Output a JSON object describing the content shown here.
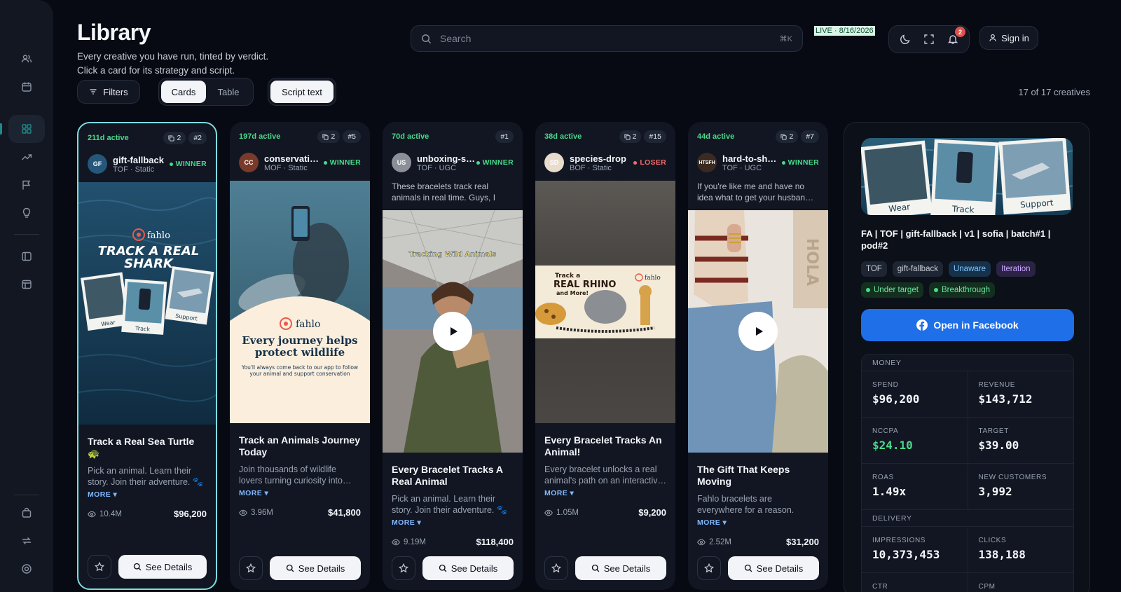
{
  "page": {
    "title": "Library",
    "subtitle_line1": "Every creative you have run, tinted by verdict.",
    "subtitle_line2": "Click a card for its strategy and script.",
    "count": "17 of 17 creatives"
  },
  "search": {
    "placeholder": "Search",
    "shortcut": "⌘K"
  },
  "header": {
    "live_badge": "LIVE · 8/16/2026",
    "notification_count": "2",
    "signin_label": "Sign in"
  },
  "toolbar": {
    "filters_label": "Filters",
    "view_options": [
      "Cards",
      "Table"
    ],
    "selected_view": "Cards",
    "script_label": "Script text"
  },
  "sidebar": {
    "items": [
      "users-icon",
      "calendar-icon",
      "grid-icon",
      "trending-icon",
      "flag-icon",
      "lightbulb-icon",
      "panel-icon",
      "layout-icon",
      "bag-icon",
      "repeat-icon",
      "target-icon"
    ],
    "active_index": 2
  },
  "cards": [
    {
      "active": "211d active",
      "copies": "2",
      "rank": "#2",
      "initials": "GF",
      "name": "gift-fallback",
      "meta": "TOF · Static",
      "verdict": "WINNER",
      "hook": "",
      "title": "Track a Real Sea Turtle 🐢",
      "body": "Pick an animal. Learn their story. Join their adventure. 🐾 …",
      "more": "MORE",
      "views": "10.4M",
      "spend": "$96,200",
      "details_label": "See Details"
    },
    {
      "active": "197d active",
      "copies": "2",
      "rank": "#5",
      "initials": "CC",
      "name": "conservati…",
      "meta": "MOF · Static",
      "verdict": "WINNER",
      "hook": "",
      "title": "Track an Animals Journey Today",
      "body": "Join thousands of wildlife lovers turning curiosity into…",
      "more": "MORE",
      "views": "3.96M",
      "spend": "$41,800",
      "details_label": "See Details"
    },
    {
      "active": "70d active",
      "copies": "",
      "rank": "#1",
      "initials": "US",
      "name": "unboxing-s…",
      "meta": "TOF · UGC",
      "verdict": "WINNER",
      "hook": "These bracelets track real animals in real time. Guys, I jus…",
      "title": "Every Bracelet Tracks A Real Animal",
      "body": "Pick an animal. Learn their story. Join their adventure. 🐾 …",
      "more": "MORE",
      "views": "9.19M",
      "spend": "$118,400",
      "details_label": "See Details"
    },
    {
      "active": "38d active",
      "copies": "2",
      "rank": "#15",
      "initials": "SD",
      "name": "species-drop",
      "meta": "BOF · Static",
      "verdict": "LOSER",
      "hook": "",
      "title": "Every Bracelet Tracks An Animal!",
      "body": "Every bracelet unlocks a real animal's path on an interactiv…",
      "more": "MORE",
      "views": "1.05M",
      "spend": "$9,200",
      "details_label": "See Details"
    },
    {
      "active": "44d active",
      "copies": "2",
      "rank": "#7",
      "initials": "HTSFH",
      "name": "hard-to-sh…",
      "meta": "TOF · UGC",
      "verdict": "WINNER",
      "hook": "If you're like me and have no idea what to get your husban…",
      "title": "The Gift That Keeps Moving",
      "body": "Fahlo bracelets are everywhere for a reason. Tracking a real…",
      "more": "MORE",
      "views": "2.52M",
      "spend": "$31,200",
      "details_label": "See Details"
    }
  ],
  "media_text": {
    "brand": "fahlo",
    "card1_headline_1": "TRACK A REAL",
    "card1_headline_2": "SHARK",
    "card1_polaroids": [
      "Wear",
      "Track",
      "Support"
    ],
    "card2_headline": "Every journey helps protect wildlife",
    "card2_sub": "You'll always come back to our app to follow your animal and support conservation",
    "card3_caption": "Tracking Wild Animals",
    "card4_line1": "Track a",
    "card4_line2": "REAL RHINO",
    "card4_line3": "and More!",
    "card5_side": "HOLA"
  },
  "panel": {
    "thumb_labels": [
      "Wear",
      "Track",
      "Support"
    ],
    "name": "FA | TOF | gift-fallback | v1 | sofia | batch#1 | pod#2",
    "tags_row1": [
      "TOF",
      "gift-fallback",
      "Unaware",
      "Iteration"
    ],
    "tags_row2": [
      "Under target",
      "Breakthrough"
    ],
    "fb_label": "Open in Facebook",
    "money_label": "MONEY",
    "delivery_label": "DELIVERY",
    "metrics": {
      "spend_label": "SPEND",
      "spend": "$96,200",
      "revenue_label": "REVENUE",
      "revenue": "$143,712",
      "nccpa_label": "NCCPA",
      "nccpa": "$24.10",
      "target_label": "TARGET",
      "target": "$39.00",
      "roas_label": "ROAS",
      "roas": "1.49x",
      "new_customers_label": "NEW CUSTOMERS",
      "new_customers": "3,992",
      "impressions_label": "IMPRESSIONS",
      "impressions": "10,373,453",
      "clicks_label": "CLICKS",
      "clicks": "138,188",
      "ctr_label": "CTR",
      "cpm_label": "CPM"
    }
  },
  "colors": {
    "accent": "#1f8a8a",
    "winner": "#4ad98a",
    "loser": "#f26b6b",
    "facebook": "#1e6fe8",
    "selected_border": "#7fdbe0"
  }
}
